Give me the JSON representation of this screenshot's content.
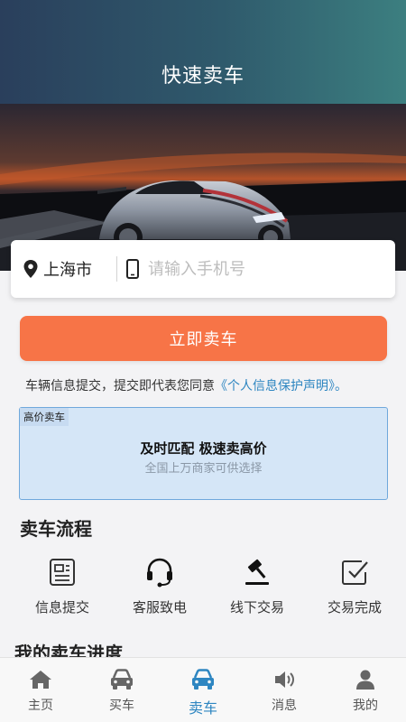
{
  "header": {
    "title": "快速卖车"
  },
  "location": {
    "city": "上海市",
    "phone_placeholder": "请输入手机号"
  },
  "sell_button": {
    "label": "立即卖车"
  },
  "agreement": {
    "text": "车辆信息提交，提交即代表您同意",
    "link": "《个人信息保护声明》",
    "suffix": "。"
  },
  "promo": {
    "tag": "高价卖车",
    "title": "及时匹配 极速卖高价",
    "subtitle": "全国上万商家可供选择"
  },
  "process": {
    "title": "卖车流程",
    "steps": [
      {
        "label": "信息提交",
        "icon": "document-icon"
      },
      {
        "label": "客服致电",
        "icon": "headset-icon"
      },
      {
        "label": "线下交易",
        "icon": "gavel-icon"
      },
      {
        "label": "交易完成",
        "icon": "checkbox-icon"
      }
    ]
  },
  "progress": {
    "title": "我的卖车进度"
  },
  "tabbar": {
    "active_color": "#2e86c1",
    "items": [
      {
        "label": "主页",
        "icon": "home-icon"
      },
      {
        "label": "买车",
        "icon": "car-icon"
      },
      {
        "label": "卖车",
        "icon": "car-icon",
        "active": true
      },
      {
        "label": "消息",
        "icon": "speaker-icon"
      },
      {
        "label": "我的",
        "icon": "user-icon"
      }
    ]
  },
  "colors": {
    "accent_orange": "#f77447",
    "link_blue": "#2e86c1",
    "promo_bg": "#d5e6f7"
  }
}
